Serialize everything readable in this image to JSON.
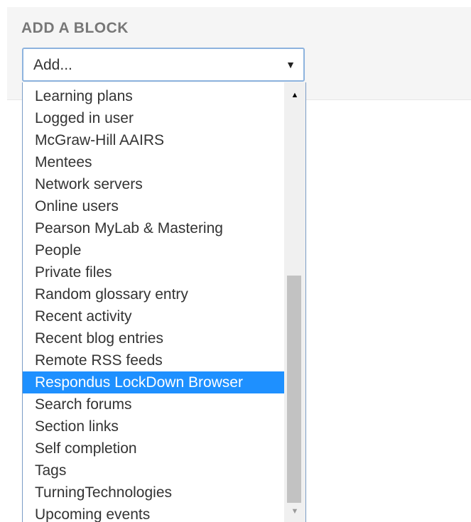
{
  "block_panel": {
    "title": "ADD A BLOCK",
    "select": {
      "value": "Add...",
      "caret_icon": "▼"
    }
  },
  "dropdown": {
    "options": [
      "Learning plans",
      "Logged in user",
      "McGraw-Hill AAIRS",
      "Mentees",
      "Network servers",
      "Online users",
      "Pearson MyLab & Mastering",
      "People",
      "Private files",
      "Random glossary entry",
      "Recent activity",
      "Recent blog entries",
      "Remote RSS feeds",
      "Respondus LockDown Browser",
      "Search forums",
      "Section links",
      "Self completion",
      "Tags",
      "TurningTechnologies",
      "Upcoming events"
    ],
    "highlighted": "Respondus LockDown Browser",
    "scrollbar": {
      "up_icon": "▲",
      "down_icon": "▼"
    }
  },
  "colors": {
    "panel_bg": "#f5f5f5",
    "title_text": "#777777",
    "select_border": "#8db3de",
    "highlight_bg": "#1e90ff",
    "highlight_text": "#ffffff"
  }
}
